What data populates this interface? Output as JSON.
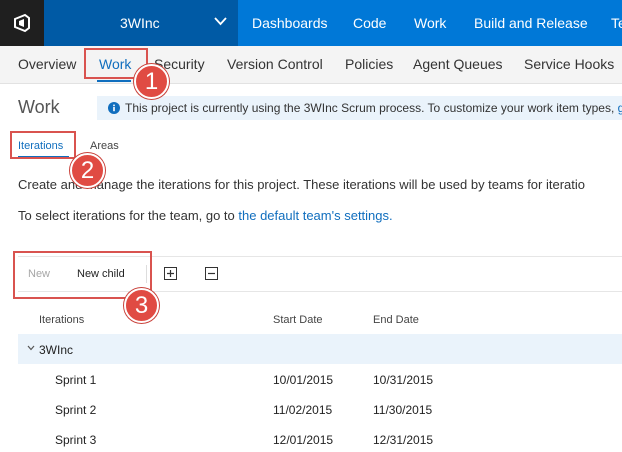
{
  "header": {
    "project_name": "3WInc",
    "nav": [
      "Dashboards",
      "Code",
      "Work",
      "Build and Release",
      "Te"
    ]
  },
  "admin_tabs": [
    "Overview",
    "Work",
    "Security",
    "Version Control",
    "Policies",
    "Agent Queues",
    "Service Hooks"
  ],
  "page": {
    "title": "Work",
    "info_text": "This project is currently using the 3WInc Scrum process. To customize your work item types, ",
    "info_link": "go"
  },
  "sub_tabs": [
    "Iterations",
    "Areas"
  ],
  "description": {
    "line1": "Create and manage the iterations for this project. These iterations will be used by teams for iteratio",
    "line2_text": "To select iterations for the team, go to ",
    "line2_link": "the default team's settings."
  },
  "toolbar": {
    "new_label": "New",
    "new_child_label": "New child"
  },
  "grid": {
    "columns": [
      "Iterations",
      "Start Date",
      "End Date"
    ],
    "root": "3WInc",
    "rows": [
      {
        "name": "Sprint 1",
        "start": "10/01/2015",
        "end": "10/31/2015"
      },
      {
        "name": "Sprint 2",
        "start": "11/02/2015",
        "end": "11/30/2015"
      },
      {
        "name": "Sprint 3",
        "start": "12/01/2015",
        "end": "12/31/2015"
      }
    ]
  },
  "callouts": [
    "1",
    "2",
    "3"
  ],
  "colors": {
    "accent": "#0078d7",
    "project_bg": "#005aa5",
    "link": "#106ebe",
    "callout": "#e04b43"
  },
  "icons": [
    "vsts-logo-icon",
    "chevron-down-icon",
    "info-icon",
    "expand-all-icon",
    "collapse-all-icon",
    "expander-chevron-icon"
  ]
}
